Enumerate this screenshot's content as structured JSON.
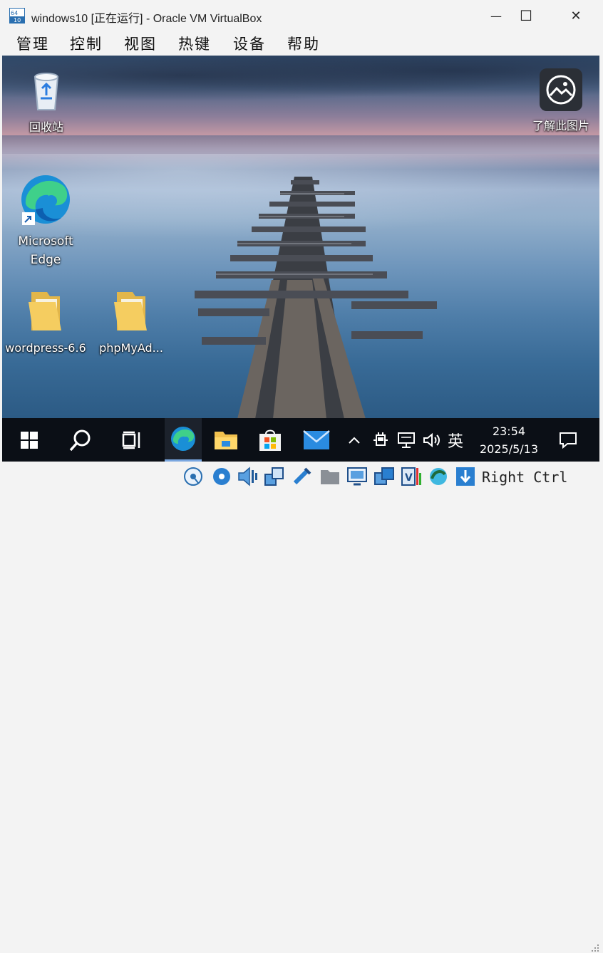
{
  "window": {
    "title": "windows10 [正在运行] - Oracle VM VirtualBox",
    "minimize_glyph": "—",
    "maximize_glyph": "☐",
    "close_glyph": "✕"
  },
  "menu": {
    "items": [
      "管理",
      "控制",
      "视图",
      "热键",
      "设备",
      "帮助"
    ]
  },
  "desktop": {
    "icons": [
      {
        "label": "回收站",
        "icon": "recycle-bin-icon"
      },
      {
        "label": "了解此图片",
        "icon": "learn-about-picture-icon"
      },
      {
        "label": "Microsoft Edge",
        "icon": "edge-icon"
      },
      {
        "label": "wordpress-6.6",
        "icon": "folder-icon"
      },
      {
        "label": "phpMyAd...",
        "icon": "folder-icon"
      }
    ]
  },
  "taskbar": {
    "tray_ime": "英",
    "time": "23:54",
    "date": "2025/5/13"
  },
  "statusbar": {
    "host_key": "Right Ctrl"
  }
}
